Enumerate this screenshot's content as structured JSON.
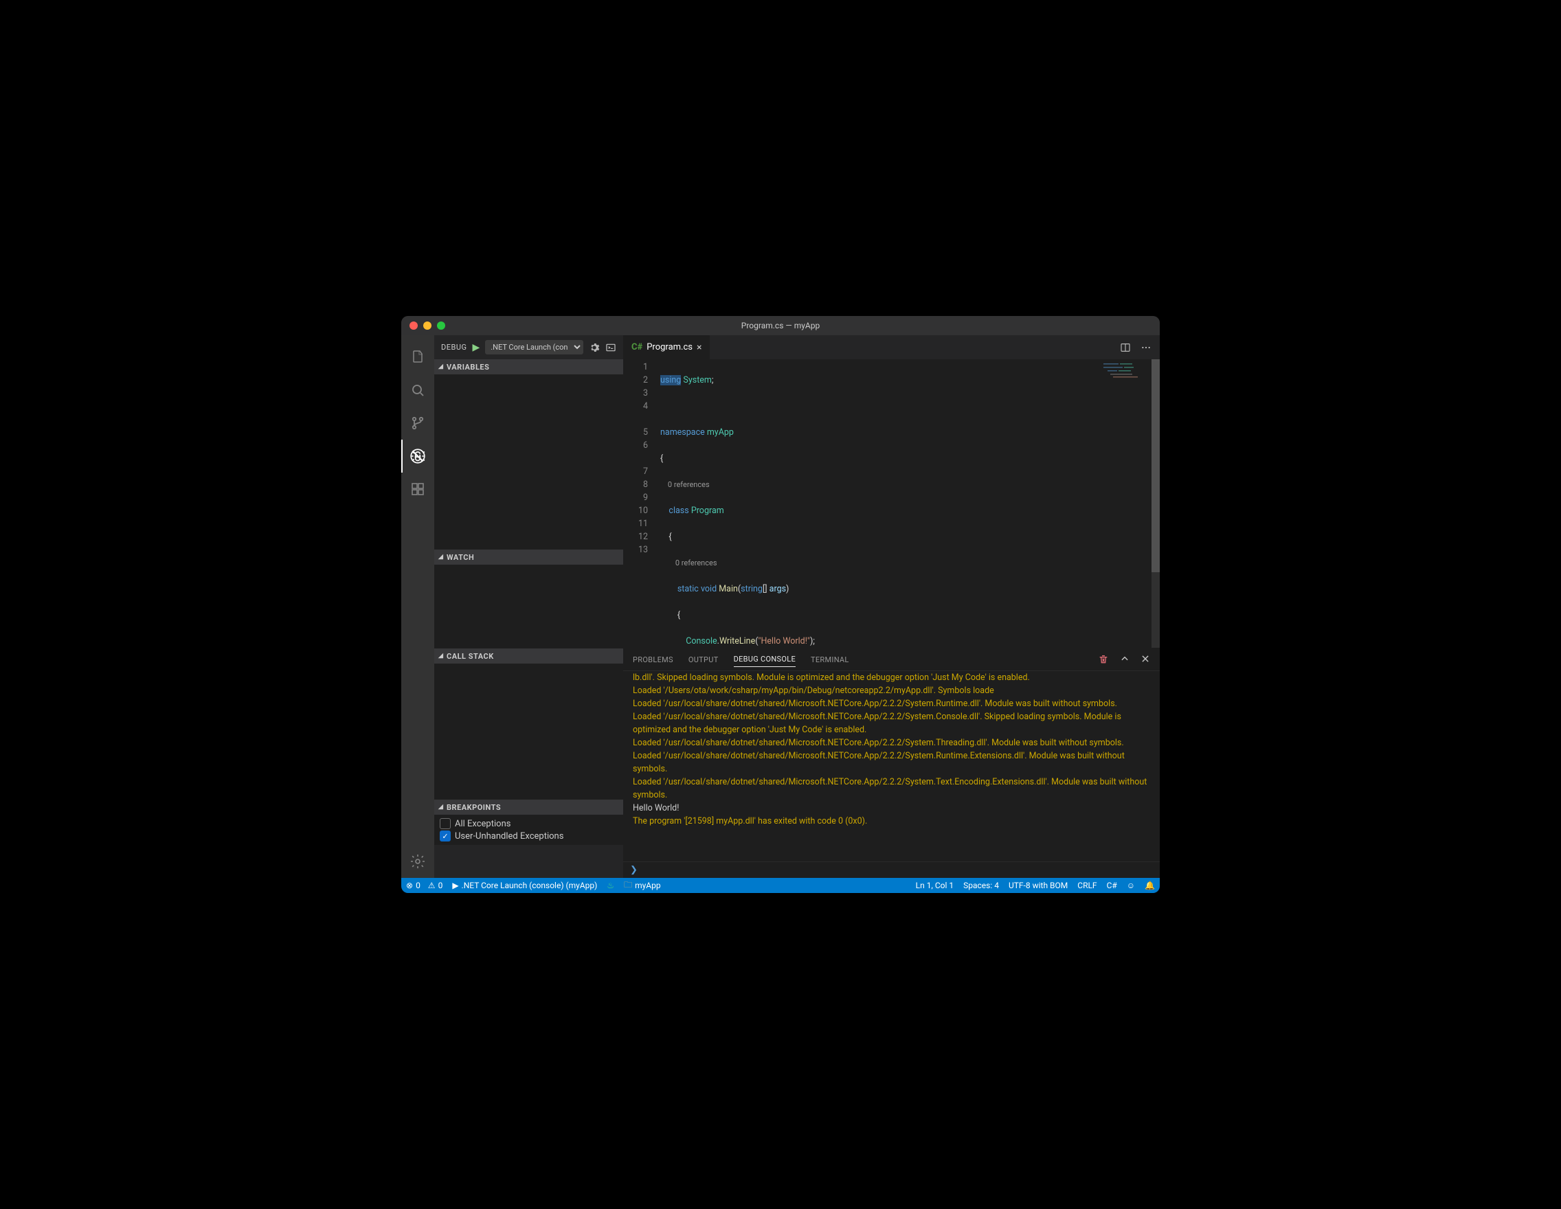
{
  "window": {
    "title": "Program.cs — myApp"
  },
  "debug": {
    "label": "DEBUG",
    "config": ".NET Core Launch (con",
    "panels": {
      "variables": "VARIABLES",
      "watch": "WATCH",
      "callstack": "CALL STACK",
      "breakpoints": "BREAKPOINTS"
    },
    "breakpoints": [
      {
        "checked": false,
        "label": "All Exceptions"
      },
      {
        "checked": true,
        "label": "User-Unhandled Exceptions"
      }
    ]
  },
  "tab": {
    "file": "Program.cs"
  },
  "code": {
    "lines": [
      1,
      2,
      3,
      4,
      5,
      6,
      7,
      8,
      9,
      10,
      11,
      12,
      13
    ],
    "codelensA": "0 references",
    "codelensB": "0 references"
  },
  "code_tokens": {
    "l1a": "using",
    "l1b": "System",
    "l1c": ";",
    "l3a": "namespace",
    "l3b": "myApp",
    "l4": "{",
    "l5a": "class",
    "l5b": "Program",
    "l6": "{",
    "l7a": "static",
    "l7b": "void",
    "l7c": "Main",
    "l7d": "(",
    "l7e": "string",
    "l7f": "[] ",
    "l7g": "args",
    "l7h": ")",
    "l8": "{",
    "l9a": "Console",
    "l9b": ".",
    "l9c": "WriteLine",
    "l9d": "(",
    "l9e": "\"Hello World!\"",
    "l9f": ");",
    "l10": "}",
    "l11": "}",
    "l12": "}"
  },
  "panel": {
    "tabs": {
      "problems": "PROBLEMS",
      "output": "OUTPUT",
      "debug": "DEBUG CONSOLE",
      "terminal": "TERMINAL"
    }
  },
  "console": {
    "lines": [
      {
        "cls": "warn",
        "text": "lb.dll'. Skipped loading symbols. Module is optimized and the debugger option 'Just My Code' is enabled."
      },
      {
        "cls": "warn",
        "text": "Loaded '/Users/ota/work/csharp/myApp/bin/Debug/netcoreapp2.2/myApp.dll'. Symbols loade"
      },
      {
        "cls": "warn",
        "text": "Loaded '/usr/local/share/dotnet/shared/Microsoft.NETCore.App/2.2.2/System.Runtime.dll'. Module was built without symbols."
      },
      {
        "cls": "warn",
        "text": "Loaded '/usr/local/share/dotnet/shared/Microsoft.NETCore.App/2.2.2/System.Console.dll'. Skipped loading symbols. Module is optimized and the debugger option 'Just My Code' is enabled."
      },
      {
        "cls": "warn",
        "text": "Loaded '/usr/local/share/dotnet/shared/Microsoft.NETCore.App/2.2.2/System.Threading.dll'. Module was built without symbols."
      },
      {
        "cls": "warn",
        "text": "Loaded '/usr/local/share/dotnet/shared/Microsoft.NETCore.App/2.2.2/System.Runtime.Extensions.dll'. Module was built without symbols."
      },
      {
        "cls": "warn",
        "text": "Loaded '/usr/local/share/dotnet/shared/Microsoft.NETCore.App/2.2.2/System.Text.Encoding.Extensions.dll'. Module was built without symbols."
      },
      {
        "cls": "out",
        "text": "Hello World!"
      },
      {
        "cls": "warn",
        "text": "The program '[21598] myApp.dll' has exited with code 0 (0x0)."
      }
    ],
    "prompt": "❯"
  },
  "status": {
    "errors": "0",
    "warnings": "0",
    "launch": ".NET Core Launch (console) (myApp)",
    "folder": "myApp",
    "pos": "Ln 1, Col 1",
    "spaces": "Spaces: 4",
    "enc": "UTF-8 with BOM",
    "eol": "CRLF",
    "lang": "C#"
  }
}
